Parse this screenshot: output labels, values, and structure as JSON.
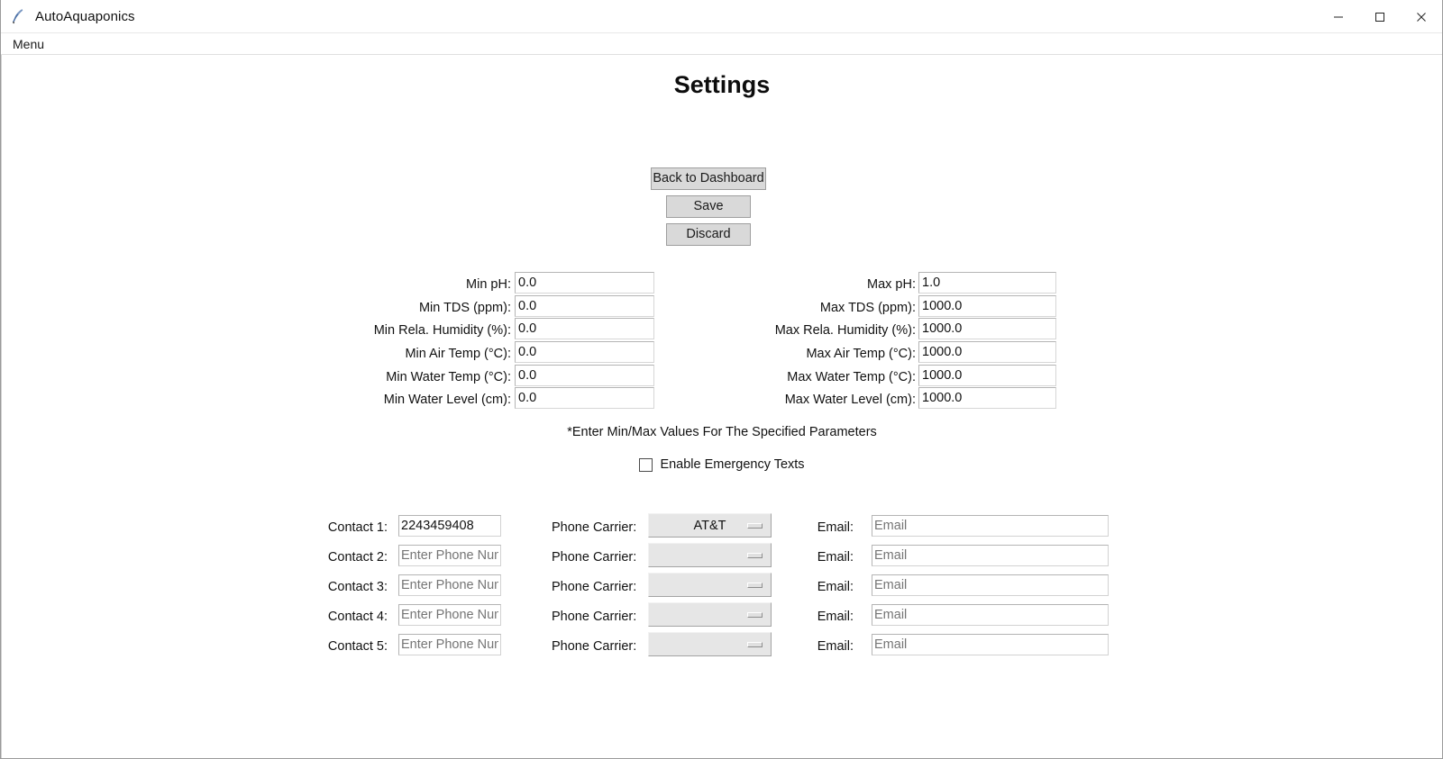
{
  "window": {
    "title": "AutoAquaponics",
    "icon": "feather-icon",
    "controls": [
      {
        "name": "minimize-button",
        "glyph": "minimize-icon"
      },
      {
        "name": "maximize-button",
        "glyph": "maximize-icon"
      },
      {
        "name": "close-button",
        "glyph": "close-icon"
      }
    ]
  },
  "menubar": {
    "items": [
      {
        "label": "Menu"
      }
    ]
  },
  "page": {
    "title": "Settings",
    "note": "*Enter Min/Max Values For The Specified Parameters"
  },
  "buttons": {
    "back": "Back to Dashboard",
    "save": "Save",
    "discard": "Discard"
  },
  "thresholds": {
    "min_rows": [
      {
        "label": "Min pH:",
        "value": "0.0"
      },
      {
        "label": "Min TDS (ppm):",
        "value": "0.0"
      },
      {
        "label": "Min Rela. Humidity (%):",
        "value": "0.0"
      },
      {
        "label": "Min Air Temp (°C):",
        "value": "0.0"
      },
      {
        "label": "Min Water Temp (°C):",
        "value": "0.0"
      },
      {
        "label": "Min Water Level (cm):",
        "value": "0.0"
      }
    ],
    "max_rows": [
      {
        "label": "Max pH:",
        "value": "1.0"
      },
      {
        "label": "Max TDS (ppm):",
        "value": "1000.0"
      },
      {
        "label": "Max Rela. Humidity (%):",
        "value": "1000.0"
      },
      {
        "label": "Max Air Temp (°C):",
        "value": "1000.0"
      },
      {
        "label": "Max Water Temp (°C):",
        "value": "1000.0"
      },
      {
        "label": "Max Water Level (cm):",
        "value": "1000.0"
      }
    ]
  },
  "emergency": {
    "checkbox_label": "Enable Emergency Texts",
    "checked": false
  },
  "contacts": {
    "carrier_label": "Phone Carrier:",
    "email_label": "Email:",
    "phone_placeholder": "Enter Phone Number",
    "email_placeholder": "Email",
    "rows": [
      {
        "label": "Contact 1:",
        "phone": "2243459408",
        "carrier": "AT&T",
        "email": ""
      },
      {
        "label": "Contact 2:",
        "phone": "",
        "carrier": "",
        "email": ""
      },
      {
        "label": "Contact 3:",
        "phone": "",
        "carrier": "",
        "email": ""
      },
      {
        "label": "Contact 4:",
        "phone": "",
        "carrier": "",
        "email": ""
      },
      {
        "label": "Contact 5:",
        "phone": "",
        "carrier": "",
        "email": ""
      }
    ]
  },
  "colors": {
    "window_bg": "#ffffff",
    "button_face": "#d9d9d9",
    "dropdown_face": "#e6e6e6",
    "text": "#111111",
    "border": "#b4b4b4"
  }
}
